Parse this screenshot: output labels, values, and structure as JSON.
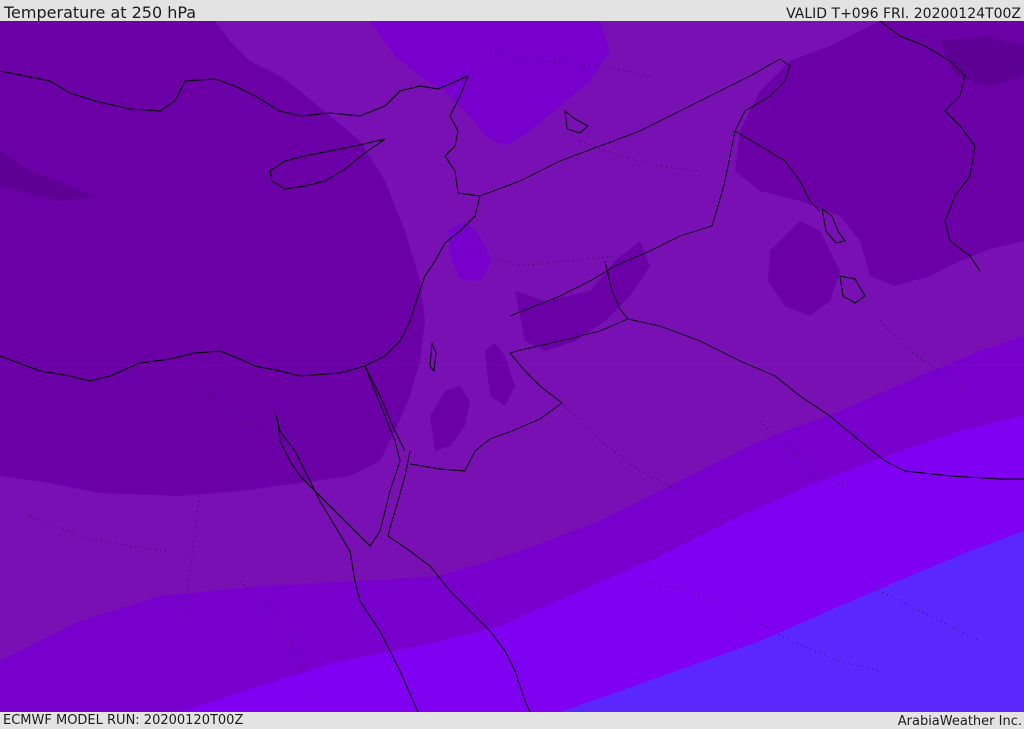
{
  "header": {
    "title": "Temperature at 250 hPa",
    "valid": "VALID T+096 FRI. 20200124T00Z"
  },
  "footer": {
    "model_run": "ECMWF MODEL RUN: 20200120T00Z",
    "credit": "ArabiaWeather Inc."
  },
  "map": {
    "variable": "temperature",
    "level": "250 hPa",
    "colors": {
      "band_coldest": "#5e0094",
      "band_cold": "#6b00a6",
      "band_mid": "#7810b4",
      "band_warm": "#7800cc",
      "band_warmer": "#8000f2",
      "band_warmest": "#5a28ff",
      "border_line": "#000000"
    }
  }
}
